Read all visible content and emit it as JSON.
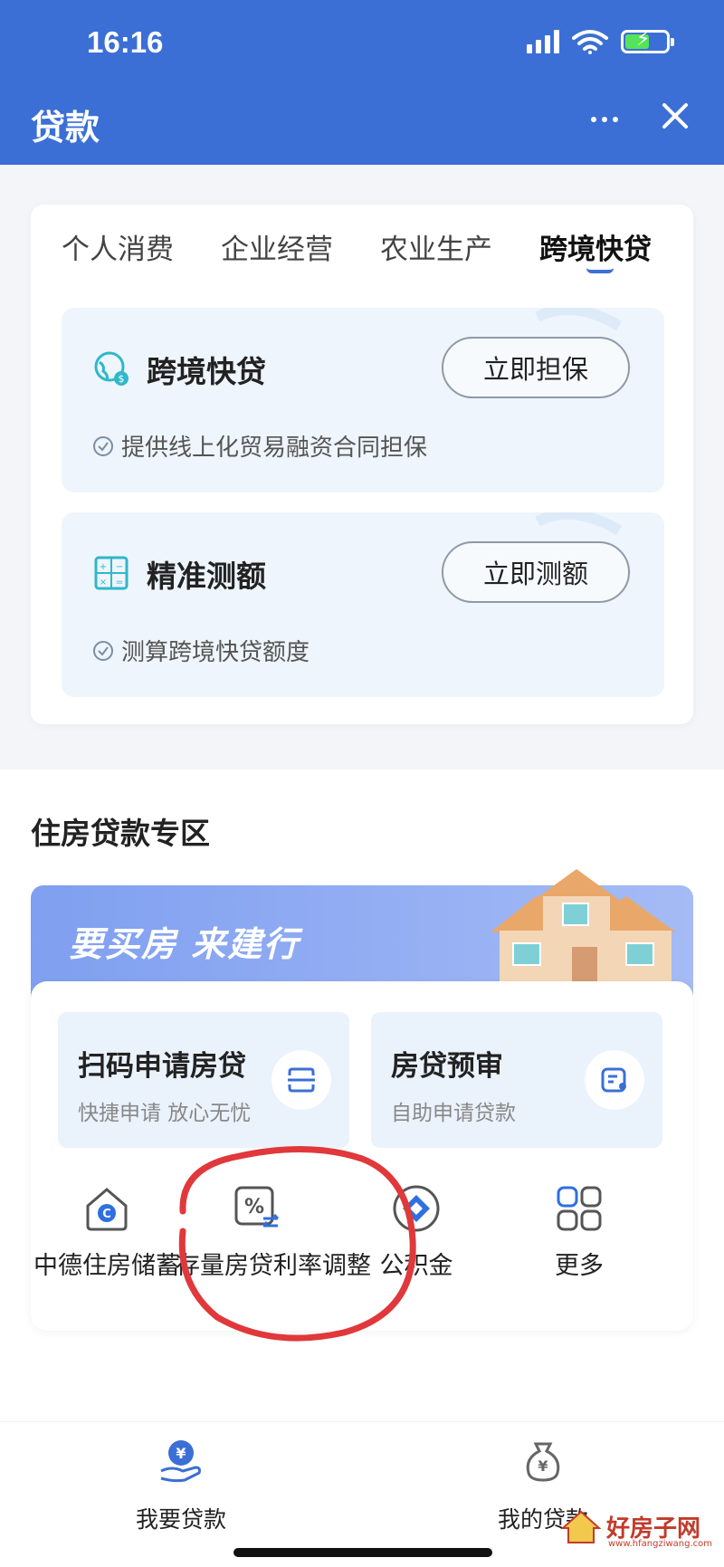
{
  "status_bar": {
    "time": "16:16"
  },
  "header": {
    "title": "贷款",
    "more_icon": "more-dots-icon",
    "close_icon": "close-icon",
    "background": "#3b6fd6"
  },
  "tabs": [
    {
      "label": "个人消费",
      "active": false
    },
    {
      "label": "企业经营",
      "active": false
    },
    {
      "label": "农业生产",
      "active": false
    },
    {
      "label": "跨境快贷",
      "active": true
    }
  ],
  "products": [
    {
      "icon": "globe-money-icon",
      "name": "跨境快贷",
      "button": "立即担保",
      "desc": "提供线上化贸易融资合同担保"
    },
    {
      "icon": "calculator-icon",
      "name": "精准测额",
      "button": "立即测额",
      "desc": "测算跨境快贷额度"
    }
  ],
  "housing": {
    "title": "住房贷款专区",
    "banner_text": "要买房 来建行",
    "cards": [
      {
        "title": "扫码申请房贷",
        "sub": "快捷申请 放心无忧",
        "icon": "scan-icon"
      },
      {
        "title": "房贷预审",
        "sub": "自助申请贷款",
        "icon": "profile-card-icon"
      }
    ],
    "shortcuts": [
      {
        "label": "中德住房储蓄",
        "icon": "house-c-icon"
      },
      {
        "label": "存量房贷利率调整",
        "icon": "percent-exchange-icon"
      },
      {
        "label": "公积金",
        "icon": "fund-diamond-icon"
      },
      {
        "label": "更多",
        "icon": "grid-more-icon"
      }
    ]
  },
  "bottom_nav": [
    {
      "label": "我要贷款",
      "icon": "hand-yen-icon"
    },
    {
      "label": "我的贷款",
      "icon": "yen-bag-icon"
    }
  ],
  "watermark": {
    "text": "好房子网",
    "sub": "www.hfangziwang.com"
  },
  "colors": {
    "accent": "#3b6fd6",
    "annotation": "#e0383b",
    "check": "#7a8ea6"
  }
}
